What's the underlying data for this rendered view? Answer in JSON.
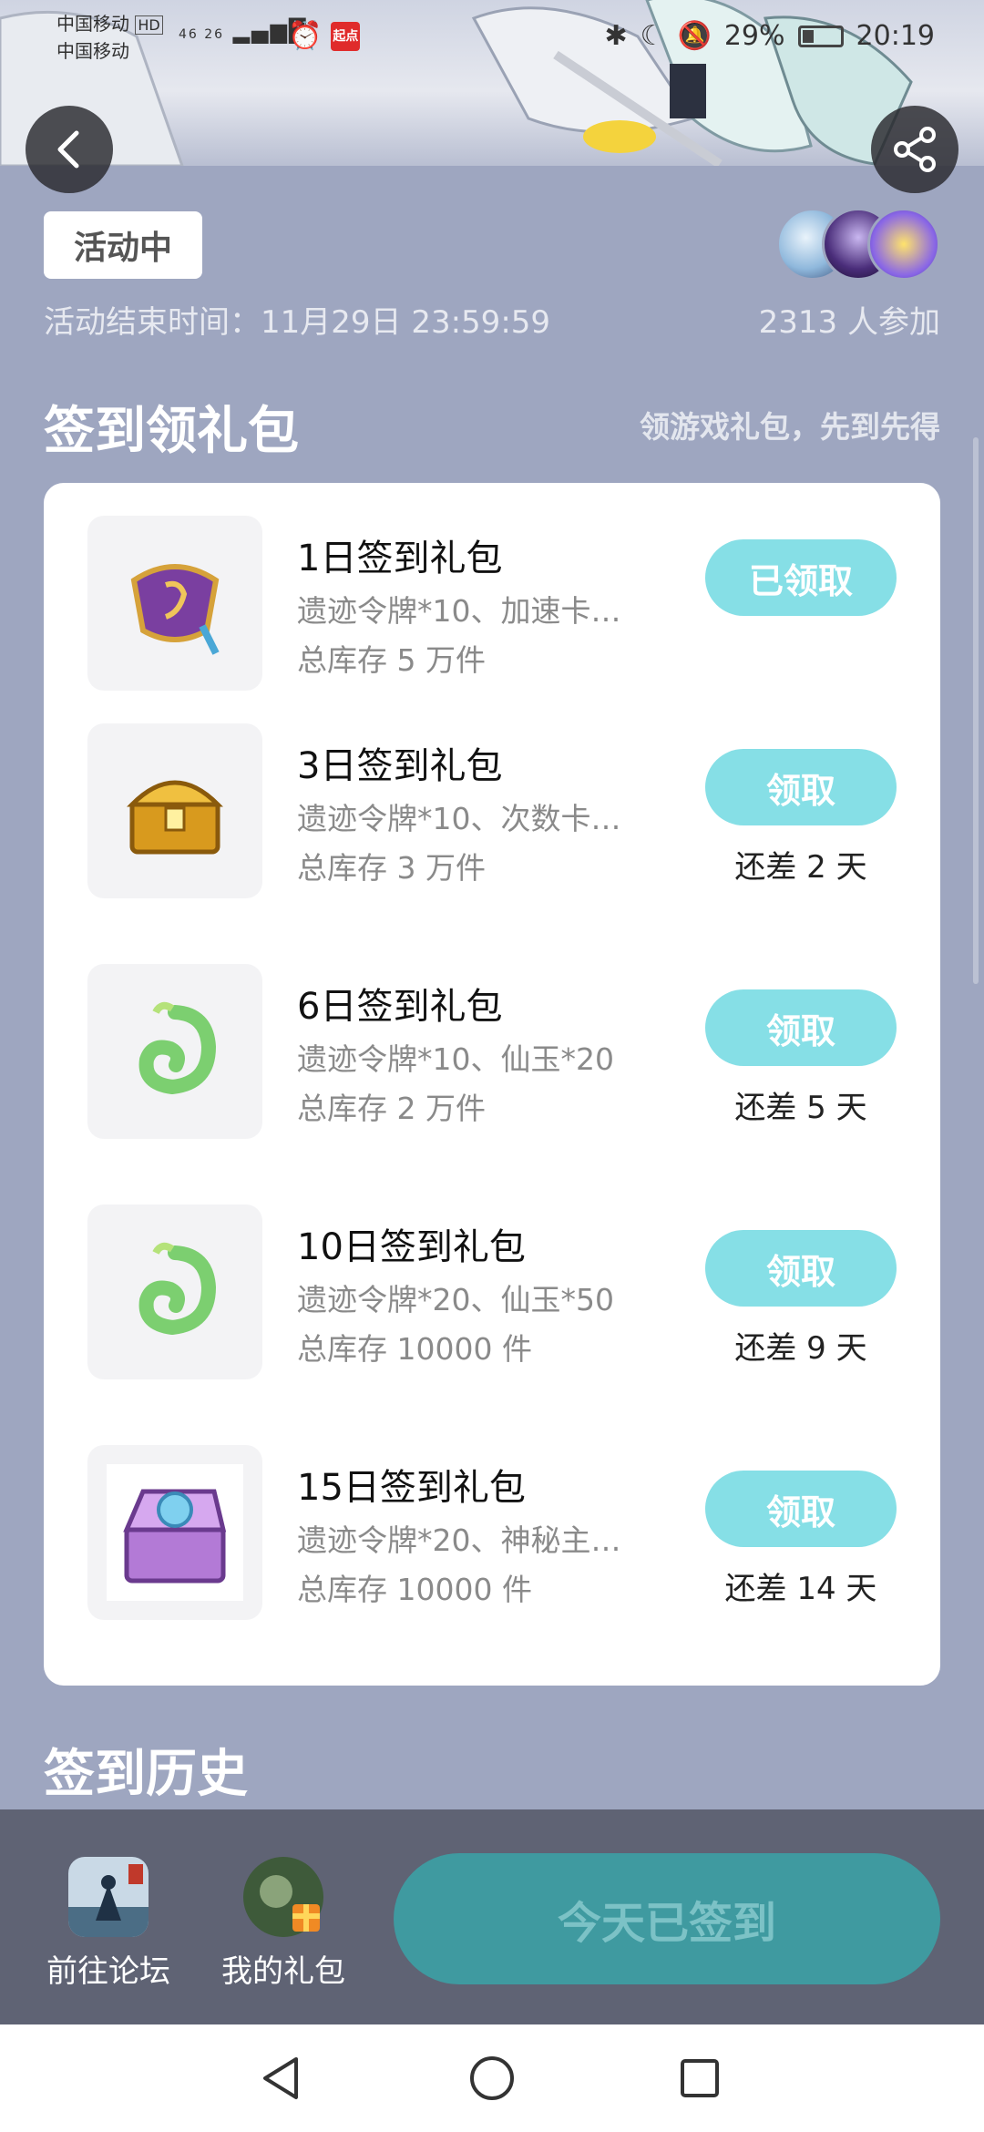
{
  "status_bar": {
    "carrier_1": "中国移动",
    "hd_badge": "HD",
    "carrier_2": "中国移动",
    "signal_text": "46 26",
    "app_badge": "起点",
    "battery": "29%",
    "time": "20:19"
  },
  "header": {
    "back_icon": "chevron-left-icon",
    "share_icon": "share-icon"
  },
  "activity": {
    "status": "活动中",
    "end_time": "活动结束时间：11月29日 23:59:59",
    "participants": "2313 人参加"
  },
  "gifts_section": {
    "title": "签到领礼包",
    "subtitle": "领游戏礼包，先到先得",
    "items": [
      {
        "name": "1日签到礼包",
        "desc": "遗迹令牌*10、加速卡…",
        "stock": "总库存 5 万件",
        "button": "已领取",
        "days_left": ""
      },
      {
        "name": "3日签到礼包",
        "desc": "遗迹令牌*10、次数卡…",
        "stock": "总库存 3 万件",
        "button": "领取",
        "days_left": "还差 2 天"
      },
      {
        "name": "6日签到礼包",
        "desc": "遗迹令牌*10、仙玉*20",
        "stock": "总库存 2 万件",
        "button": "领取",
        "days_left": "还差 5 天"
      },
      {
        "name": "10日签到礼包",
        "desc": "遗迹令牌*20、仙玉*50",
        "stock": "总库存 10000 件",
        "button": "领取",
        "days_left": "还差 9 天"
      },
      {
        "name": "15日签到礼包",
        "desc": "遗迹令牌*20、神秘主…",
        "stock": "总库存 10000 件",
        "button": "领取",
        "days_left": "还差 14 天"
      }
    ]
  },
  "history_section": {
    "title": "签到历史"
  },
  "bottom_bar": {
    "forum_label": "前往论坛",
    "my_gifts_label": "我的礼包",
    "signed_label": "今天已签到"
  },
  "colors": {
    "page_bg": "#9ea6c0",
    "accent": "#86dfe6",
    "signed_button": "#3f9aa0"
  }
}
